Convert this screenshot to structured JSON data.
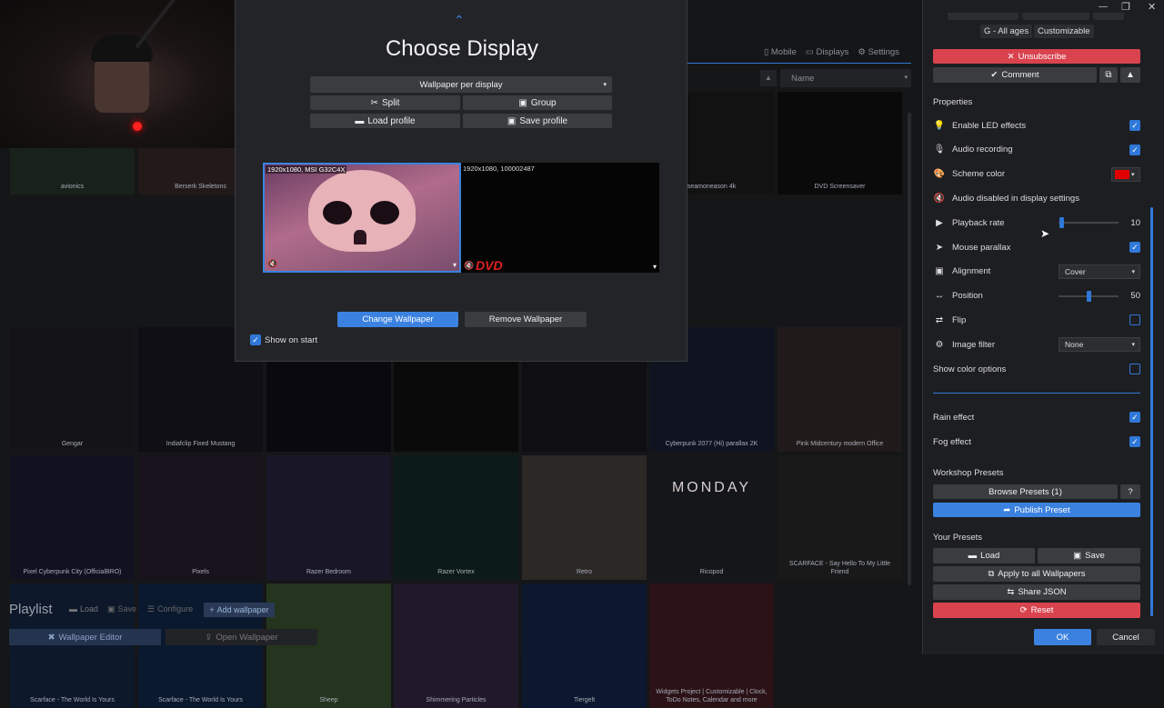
{
  "library": {
    "top_tabs": [
      {
        "icon": "mobile-icon",
        "label": "Mobile"
      },
      {
        "icon": "displays-icon",
        "label": "Displays"
      },
      {
        "icon": "gear-icon",
        "label": "Settings"
      }
    ],
    "sort_label": "Name",
    "tiles": [
      {
        "label": "avionics",
        "bg": "#2a3a2e"
      },
      {
        "label": "Berserk Skeletons",
        "bg": "#3b2b2b"
      },
      {
        "label": "",
        "bg": "#0d0d0d"
      },
      {
        "label": "",
        "bg": "#1a1a1a"
      },
      {
        "label": "",
        "bg": "#161616"
      },
      {
        "label": "",
        "bg": "#151515"
      },
      {
        "label": "",
        "bg": "#0f0f12"
      },
      {
        "label": "Gengar",
        "bg": "#232427"
      },
      {
        "label": "Indiafclip Fixed Mustang",
        "bg": "#1d1a25"
      },
      {
        "label": "",
        "bg": "#11111a"
      },
      {
        "label": "",
        "bg": "#121212"
      },
      {
        "label": "",
        "bg": "#1a1a1e"
      },
      {
        "label": "Cyberpunk 2077 (Hi) parallax 2K",
        "bg": "#1b2438"
      },
      {
        "label": "Pink Midcentury modern Office",
        "bg": "#3a2e2e"
      },
      {
        "label": "Pixel Cyberpunk City (OfficialBRO)",
        "bg": "#1e2036"
      },
      {
        "label": "Pixels",
        "bg": "#2a1f33"
      },
      {
        "label": "Razer Bedroom",
        "bg": "#2b2844"
      },
      {
        "label": "Razer Vortex",
        "bg": "#163028"
      },
      {
        "label": "Retro",
        "bg": "#4a4540"
      },
      {
        "label": "Ricopod",
        "bg": "#25272c"
      },
      {
        "label": "SCARFACE - Say Hello To My Little Friend",
        "bg": "#2c2c2c"
      },
      {
        "label": "Scarface - The World Is Yours",
        "bg": "#172a4a"
      },
      {
        "label": "Scarface - The World Is Yours",
        "bg": "#132c52"
      },
      {
        "label": "Sheep",
        "bg": "#3f5a34"
      },
      {
        "label": "Shimmering Particles",
        "bg": "#3a2a4a"
      },
      {
        "label": "Tiergelt",
        "bg": "#152a52"
      },
      {
        "label": "Widgets Project | Customizable | Clock, ToDo Notes, Calendar and more",
        "bg": "#4a1f27"
      }
    ],
    "dvd_label": "DVD Screensaver",
    "seaside_label": "seamoneason 4k",
    "monday_text": "MONDAY",
    "playlist": {
      "title": "Playlist",
      "load": "Load",
      "save": "Save",
      "configure": "Configure",
      "add": "Add wallpaper"
    },
    "bottom": {
      "editor": "Wallpaper Editor",
      "open": "Open Wallpaper"
    }
  },
  "dialog": {
    "title": "Choose Display",
    "mode_select": "Wallpaper per display",
    "split": "Split",
    "group": "Group",
    "load_profile": "Load profile",
    "save_profile": "Save profile",
    "displays": [
      {
        "label": "1920x1080, MSI G32C4X"
      },
      {
        "label": "1920x1080, 100002487"
      }
    ],
    "dvd_logo": "DVD",
    "change": "Change Wallpaper",
    "remove": "Remove Wallpaper",
    "show_on_start": "Show on start"
  },
  "panel": {
    "tags": [
      "G - All ages",
      "Customizable"
    ],
    "unsubscribe": "Unsubscribe",
    "comment": "Comment",
    "properties_title": "Properties",
    "props": [
      {
        "label": "Enable LED effects",
        "icon": "lightbulb-icon",
        "glyph": "💡",
        "type": "check",
        "checked": true
      },
      {
        "label": "Audio recording",
        "icon": "microphone-icon",
        "glyph": "🎙",
        "type": "check",
        "checked": true
      },
      {
        "label": "Scheme color",
        "icon": "palette-icon",
        "glyph": "🎨",
        "type": "color",
        "value": "#e00000"
      },
      {
        "label": "Audio disabled in display settings",
        "icon": "muted-speaker-icon",
        "glyph": "🔇",
        "type": "info"
      },
      {
        "label": "Playback rate",
        "icon": "play-icon",
        "glyph": "▶",
        "type": "slider",
        "value": "10",
        "fraction": 0.02
      },
      {
        "label": "Mouse parallax",
        "icon": "cursor-icon",
        "glyph": "➤",
        "type": "check",
        "checked": true
      },
      {
        "label": "Alignment",
        "icon": "image-icon",
        "glyph": "▣",
        "type": "select",
        "value": "Cover"
      },
      {
        "label": "Position",
        "icon": "arrows-horizontal-icon",
        "glyph": "↔",
        "type": "slider",
        "value": "50",
        "fraction": 0.5
      },
      {
        "label": "Flip",
        "icon": "flip-icon",
        "glyph": "⇄",
        "type": "check",
        "checked": false
      },
      {
        "label": "Image filter",
        "icon": "filter-icon",
        "glyph": "⚙",
        "type": "select",
        "value": "None"
      },
      {
        "label": "Show color options",
        "icon": "",
        "glyph": "",
        "type": "check",
        "checked": false
      }
    ],
    "effects": [
      {
        "label": "Rain effect",
        "checked": true
      },
      {
        "label": "Fog effect",
        "checked": true
      }
    ],
    "workshop_presets": "Workshop Presets",
    "browse_presets": "Browse Presets (1)",
    "help": "?",
    "publish_preset": "Publish Preset",
    "your_presets": "Your Presets",
    "load": "Load",
    "save": "Save",
    "apply_all": "Apply to all Wallpapers",
    "share_json": "Share JSON",
    "reset": "Reset",
    "ok": "OK",
    "cancel": "Cancel",
    "colors": {
      "accent": "#2f78d8",
      "danger": "#d9434e"
    }
  }
}
